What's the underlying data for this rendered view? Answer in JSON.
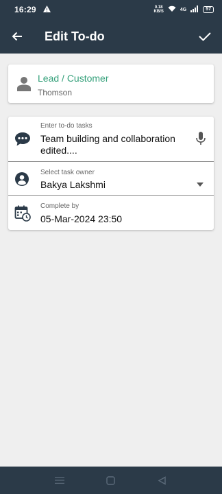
{
  "status_bar": {
    "time": "16:29",
    "speed_value": "0.18",
    "speed_unit": "KB/S",
    "network": "4G",
    "battery": "57"
  },
  "app_bar": {
    "title": "Edit To-do"
  },
  "lead": {
    "title": "Lead / Customer",
    "name": "Thomson"
  },
  "task": {
    "label": "Enter to-do tasks",
    "value": "Team building and collaboration edited...."
  },
  "owner": {
    "label": "Select task owner",
    "value": "Bakya Lakshmi"
  },
  "complete": {
    "label": "Complete by",
    "value": "05-Mar-2024 23:50"
  },
  "colors": {
    "app_bar": "#2b3a48",
    "accent_green": "#34a07a",
    "icon_dark": "#2b3a48",
    "background": "#efefef"
  },
  "icons": [
    "back-arrow-icon",
    "check-icon",
    "person-icon",
    "chat-icon",
    "mic-icon",
    "account-circle-icon",
    "dropdown-arrow-icon",
    "calendar-clock-icon",
    "menu-icon",
    "home-icon",
    "back-icon"
  ]
}
